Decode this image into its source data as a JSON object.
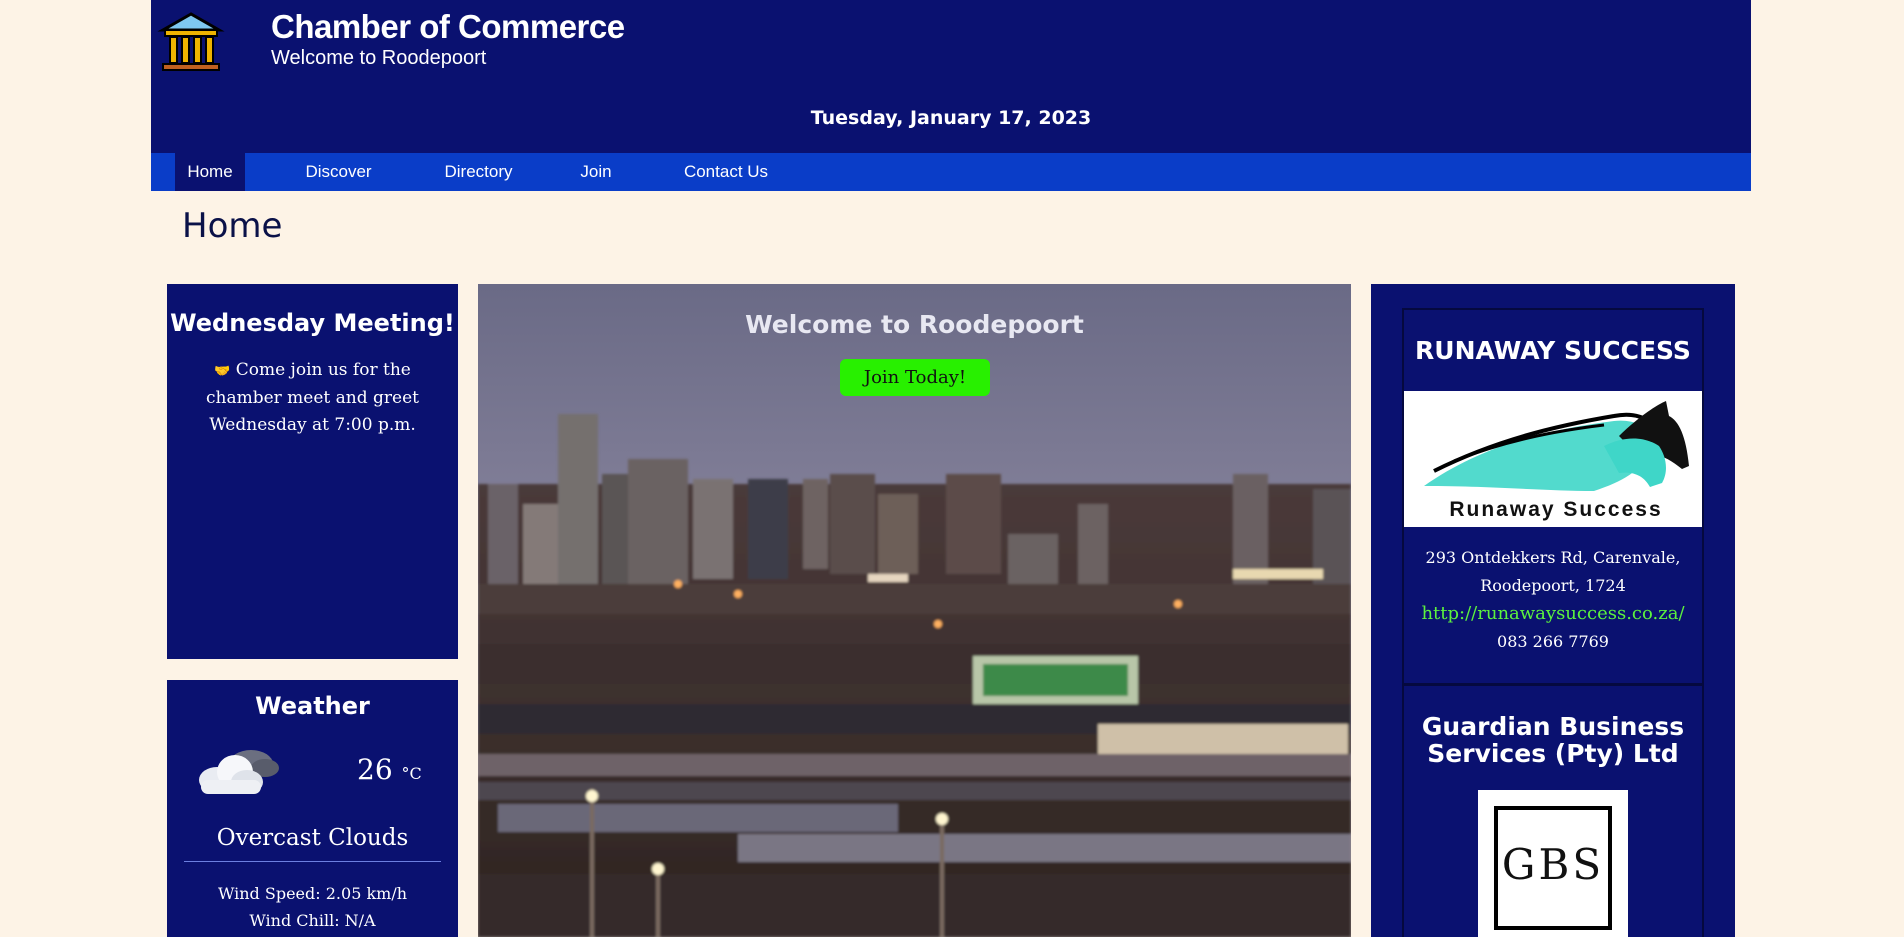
{
  "header": {
    "title": "Chamber of Commerce",
    "subtitle": "Welcome to Roodepoort",
    "date": "Tuesday, January 17, 2023",
    "logo_icon": "columns-building-icon"
  },
  "nav": {
    "items": [
      {
        "label": "Home",
        "active": true
      },
      {
        "label": "Discover",
        "active": false
      },
      {
        "label": "Directory",
        "active": false
      },
      {
        "label": "Join",
        "active": false
      },
      {
        "label": "Contact Us",
        "active": false
      }
    ]
  },
  "page": {
    "title": "Home"
  },
  "meeting": {
    "title": "Wednesday Meeting!",
    "text": "Come join us for the chamber meet and greet Wednesday at 7:00 p.m."
  },
  "weather": {
    "title": "Weather",
    "temp": "26",
    "unit": "°C",
    "condition": "Overcast Clouds",
    "wind_speed": "Wind Speed: 2.05 km/h",
    "wind_chill": "Wind Chill: N/A"
  },
  "hero": {
    "title": "Welcome to Roodepoort",
    "button": "Join Today!"
  },
  "spotlights": [
    {
      "name": "RUNAWAY SUCCESS",
      "logo_text": "Runaway Success",
      "address1": "293 Ontdekkers Rd, Carenvale,",
      "address2": "Roodepoort, 1724",
      "url": "http://runawaysuccess.co.za/",
      "phone": "083 266 7769"
    },
    {
      "name_line1": "Guardian Business",
      "name_line2": "Services (Pty) Ltd",
      "logo_text": "GBS"
    }
  ],
  "colors": {
    "page_bg": "#fdf3e6",
    "header_bg": "#0a1170",
    "nav_bg": "#0a3dc8",
    "button_green": "#28f000",
    "link_green": "#5cf23e"
  }
}
